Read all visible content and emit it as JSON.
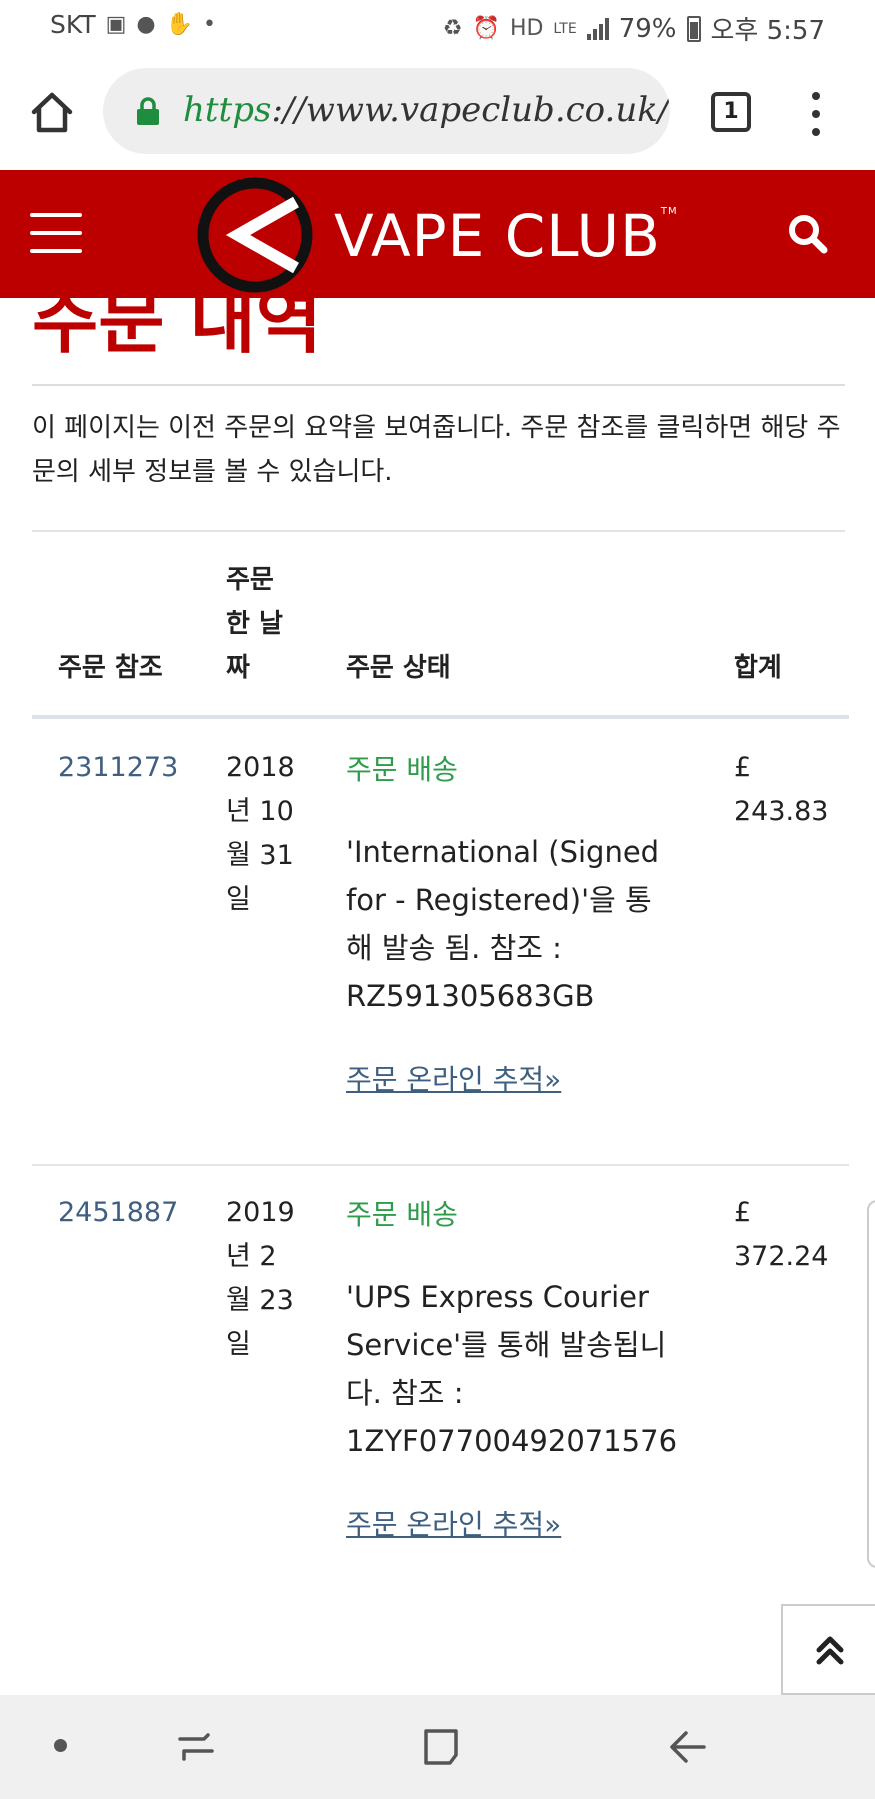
{
  "status_bar": {
    "carrier": "SKT",
    "network": "LTE",
    "battery": "79%",
    "time": "오후 5:57"
  },
  "browser": {
    "url_scheme": "https",
    "url_rest": "://www.vapeclub.co.uk/",
    "tab_count": "1"
  },
  "site_header": {
    "logo_text": "VAPE CLUB",
    "logo_tm": "TM",
    "brand_color": "#bc0000"
  },
  "page": {
    "title": "주문 내역",
    "intro": "이 페이지는 이전 주문의 요약을 보여줍니다. 주문 참조를 클릭하면 해당 주문의 세부 정보를 볼 수 있습니다."
  },
  "table": {
    "headers": {
      "ref": "주문 참조",
      "date": "주문 한 날짜",
      "status": "주문 상태",
      "total": "합계"
    },
    "rows": [
      {
        "ref": "2311273",
        "date": "2018 년 10 월 31 일",
        "status": "주문 배송",
        "description": "'International (Signed for - Registered)'을 통해 발송 됨. 참조 : RZ591305683GB",
        "track": "주문 온라인 추적»",
        "total": "£ 243.83"
      },
      {
        "ref": "2451887",
        "date": "2019 년 2 월 23 일",
        "status": "주문 배송",
        "description": "'UPS Express Courier Service'를 통해 발송됩니다. 참조 : 1ZYF07700492071576",
        "track": "주문 온라인 추적»",
        "total": "£ 372.24"
      }
    ]
  },
  "colors": {
    "status_green": "#2e9c4a",
    "link_blue": "#3f5f80"
  }
}
